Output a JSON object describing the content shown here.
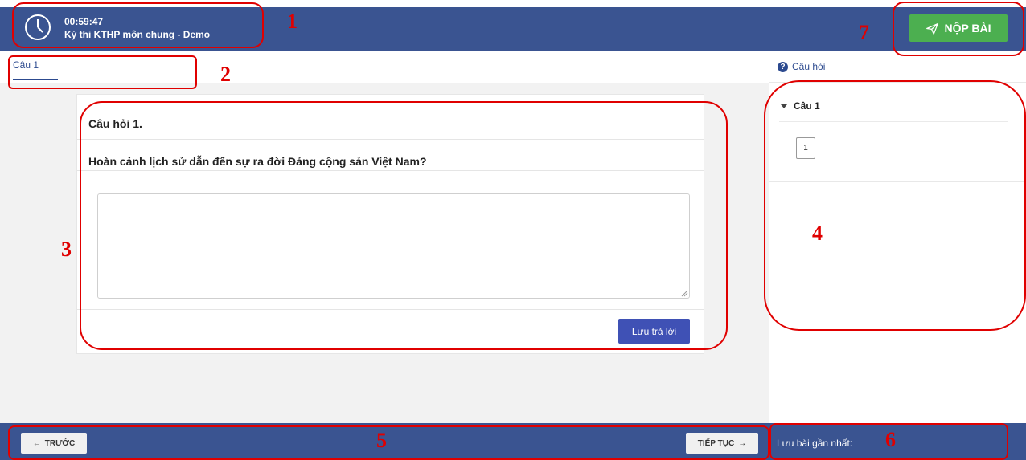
{
  "header": {
    "timer": "00:59:47",
    "exam_title": "Kỳ thi KTHP môn chung - Demo",
    "submit_label": "NỘP BÀI",
    "submit_icon": "send-icon",
    "clock_icon": "clock-icon"
  },
  "tabs": [
    {
      "label": "Câu 1",
      "active": true
    }
  ],
  "question": {
    "number_label": "Câu hỏi 1.",
    "text": "Hoàn cảnh lịch sử dẫn đến sự ra đời Đảng cộng sản Việt Nam?",
    "answer_value": "",
    "save_label": "Lưu trả lời"
  },
  "right_panel": {
    "tab_label": "Câu hỏi",
    "tab_icon": "help-icon",
    "group_label": "Câu 1",
    "question_buttons": [
      "1"
    ]
  },
  "footer": {
    "prev_label": "TRƯỚC",
    "next_label": "TIẾP TỤC",
    "last_saved_label": "Lưu bài gần nhất:"
  },
  "annotations": [
    "1",
    "2",
    "3",
    "4",
    "5",
    "6",
    "7"
  ],
  "colors": {
    "header_bg": "#3a5491",
    "submit_bg": "#4caf50",
    "save_bg": "#3f51b5",
    "annotation": "#e00000"
  }
}
